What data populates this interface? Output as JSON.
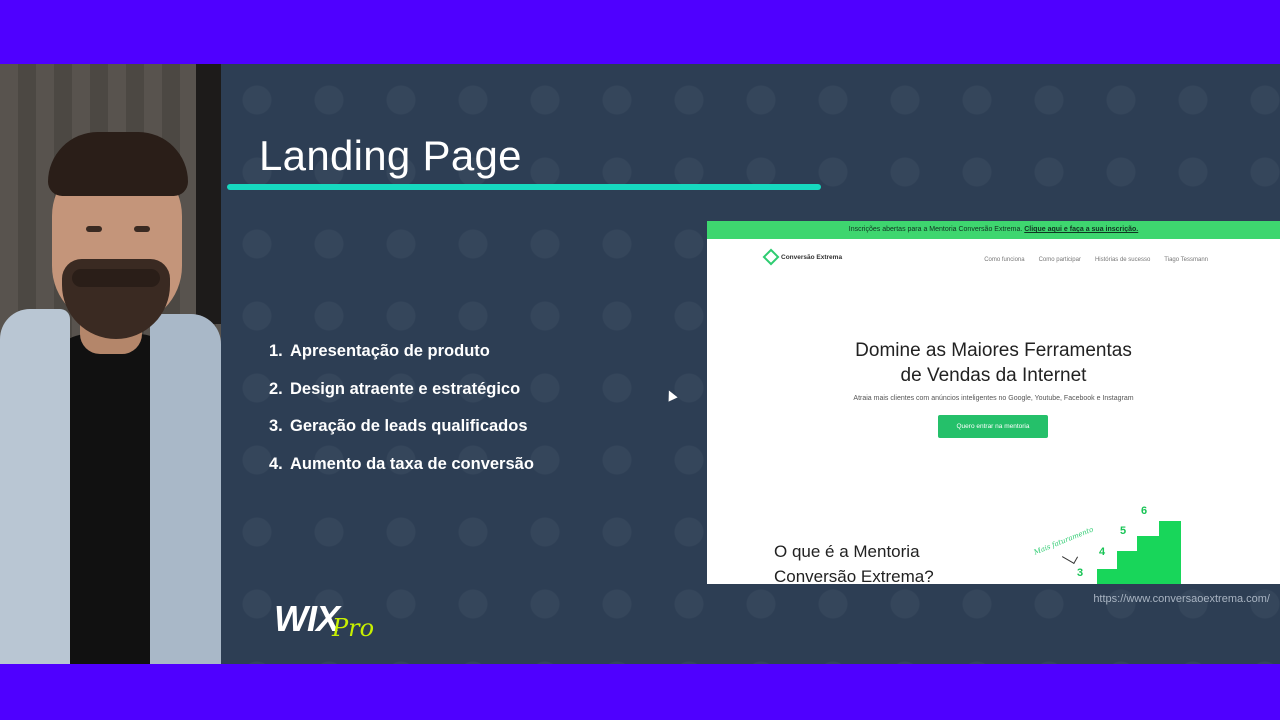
{
  "slide": {
    "title": "Landing Page",
    "items": [
      {
        "num": "1.",
        "text": "Apresentação de produto"
      },
      {
        "num": "2.",
        "text": "Design atraente e estratégico"
      },
      {
        "num": "3.",
        "text": "Geração de leads qualificados"
      },
      {
        "num": "4.",
        "text": "Aumento da taxa de conversão"
      }
    ],
    "url": "https://www.conversaoextrema.com/",
    "logo": {
      "wix": "WIX",
      "pro": "Pro"
    }
  },
  "site": {
    "banner_text": "Inscrições abertas para a Mentoria Conversão Extrema. ",
    "banner_link": "Clique aqui e faça a sua inscrição.",
    "brand": "Conversão Extrema",
    "menu": [
      "Como funciona",
      "Como participar",
      "Histórias de sucesso",
      "Tiago Tessmann"
    ],
    "headline_1": "Domine as Maiores Ferramentas",
    "headline_2": "de Vendas da Internet",
    "subhead": "Atraia mais clientes com anúncios inteligentes no Google, Youtube, Facebook e Instagram",
    "cta": "Quero entrar na mentoria",
    "section_title_1": "O que é a Mentoria",
    "section_title_2": "Conversão Extrema?",
    "script_text": "Mais faturamento",
    "steps": [
      "3",
      "4",
      "5",
      "6"
    ]
  },
  "colors": {
    "outer_background": "#4f00ff",
    "slide_background": "#2d3e54",
    "accent_underline": "#16d9c0",
    "site_green": "#3ed66f",
    "logo_pro": "#c8f000"
  }
}
